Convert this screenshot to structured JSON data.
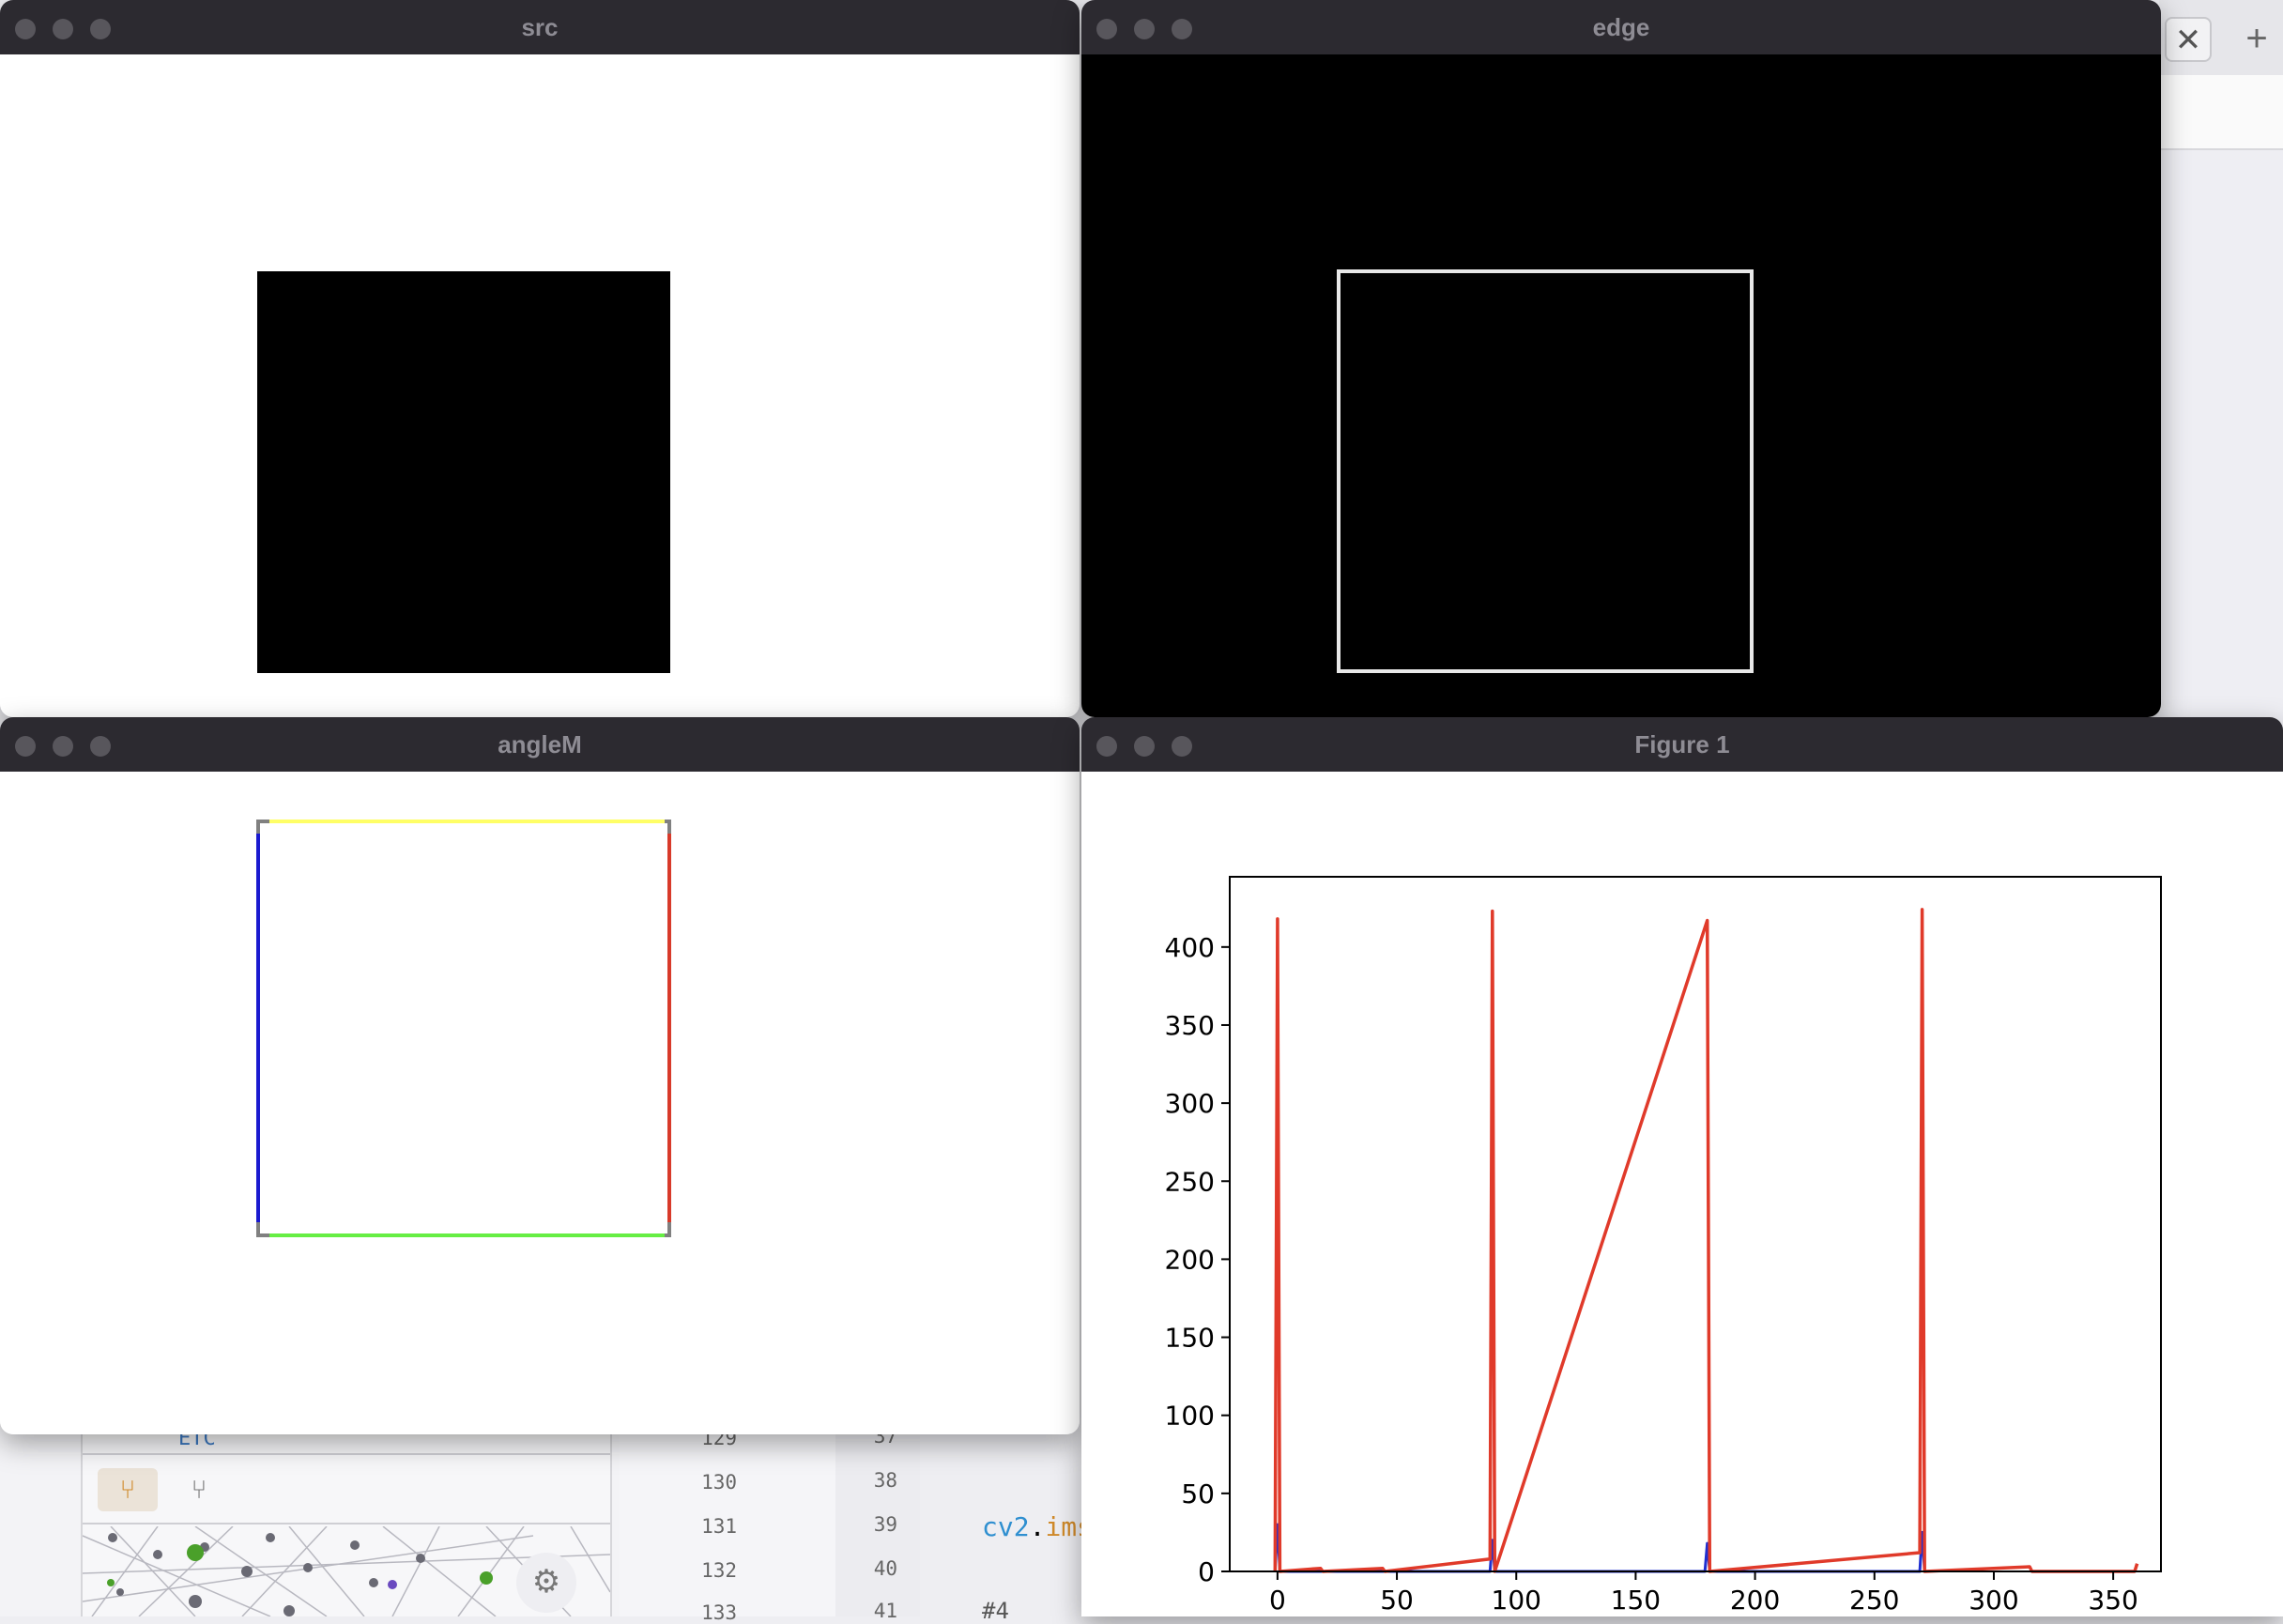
{
  "windows": {
    "src": {
      "title": "src"
    },
    "edge": {
      "title": "edge"
    },
    "angle": {
      "title": "angleM"
    },
    "figure": {
      "title": "Figure 1"
    }
  },
  "angle_edges": {
    "top": "#ffff66",
    "left": "#1a1ad0",
    "right": "#d83a2a",
    "bottom": "#66ee44",
    "corners": "#808080"
  },
  "background": {
    "tab_close_glyph": "✕",
    "tab_add_glyph": "+",
    "tree_item": "ETC",
    "line_numbers_a": [
      "129",
      "130",
      "131",
      "132",
      "133"
    ],
    "line_numbers_b": [
      "37",
      "38",
      "39",
      "40",
      "41"
    ],
    "code_module": "cv2",
    "code_dot": ".",
    "code_call": "ims",
    "code_comment": "#4",
    "icons": [
      "git-graph-icon",
      "git-branch-icon",
      "gear-icon"
    ]
  },
  "chart_data": {
    "type": "line",
    "title": "",
    "xlabel": "",
    "ylabel": "",
    "xlim": [
      -20,
      370
    ],
    "ylim": [
      0,
      445
    ],
    "xticks": [
      0,
      50,
      100,
      150,
      200,
      250,
      300,
      350
    ],
    "yticks": [
      0,
      50,
      100,
      150,
      200,
      250,
      300,
      350,
      400
    ],
    "grid": false,
    "series": [
      {
        "color": "#1f2fd0",
        "points": [
          [
            -1,
            0
          ],
          [
            0,
            30
          ],
          [
            1,
            0
          ],
          [
            89,
            0
          ],
          [
            90,
            20
          ],
          [
            91,
            0
          ],
          [
            179,
            0
          ],
          [
            180,
            18
          ],
          [
            181,
            0
          ],
          [
            269,
            0
          ],
          [
            270,
            25
          ],
          [
            271,
            0
          ]
        ]
      },
      {
        "color": "#e03a2a",
        "points": [
          [
            -1,
            0
          ],
          [
            0,
            418
          ],
          [
            1,
            0
          ],
          [
            18,
            2
          ],
          [
            19,
            0
          ],
          [
            44,
            2
          ],
          [
            45,
            0
          ],
          [
            89,
            8
          ],
          [
            90,
            423
          ],
          [
            91,
            0
          ],
          [
            180,
            417
          ],
          [
            181,
            0
          ],
          [
            269,
            12
          ],
          [
            270,
            424
          ],
          [
            271,
            0
          ],
          [
            315,
            3
          ],
          [
            316,
            0
          ],
          [
            359,
            0
          ],
          [
            360,
            5
          ]
        ]
      }
    ]
  }
}
